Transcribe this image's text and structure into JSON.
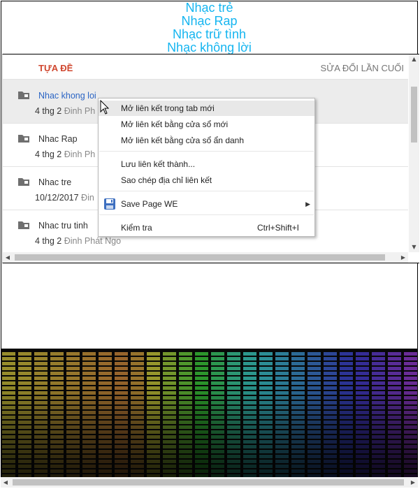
{
  "header": {
    "lines": [
      "Nhạc trẻ",
      "Nhạc Rap",
      "Nhạc trữ tình",
      "Nhạc không lời"
    ]
  },
  "list": {
    "col_title": "TỰA ĐỀ",
    "col_modified": "SỬA ĐỔI LẦN CUỐI",
    "rows": [
      {
        "name": "Nhac khong loi",
        "date": "4 thg 2",
        "owner": "Đinh Ph",
        "selected": true
      },
      {
        "name": "Nhac Rap",
        "date": "4 thg 2",
        "owner": "Đinh Ph"
      },
      {
        "name": "Nhac tre",
        "date": "10/12/2017",
        "owner": "Đin"
      },
      {
        "name": "Nhac tru tinh",
        "date": "4 thg 2",
        "owner": "Đinh Phát Ngo"
      }
    ]
  },
  "context_menu": {
    "items": [
      {
        "label": "Mở liên kết trong tab mới"
      },
      {
        "label": "Mở liên kết bằng cửa sổ mới"
      },
      {
        "label": "Mở liên kết bằng cửa sổ ẩn danh"
      },
      {
        "label": "Lưu liên kết thành..."
      },
      {
        "label": "Sao chép địa chỉ liên kết"
      },
      {
        "label": "Save Page WE",
        "icon": "floppy-disk-icon"
      },
      {
        "label": "Kiểm tra",
        "shortcut": "Ctrl+Shift+I"
      }
    ]
  },
  "colors": {
    "header_text": "#15b5f0",
    "title_col": "#d0472f",
    "link": "#2a64c4"
  },
  "icons": [
    "folder-icon",
    "floppy-disk-icon",
    "submenu-arrow-icon",
    "cursor-icon"
  ]
}
